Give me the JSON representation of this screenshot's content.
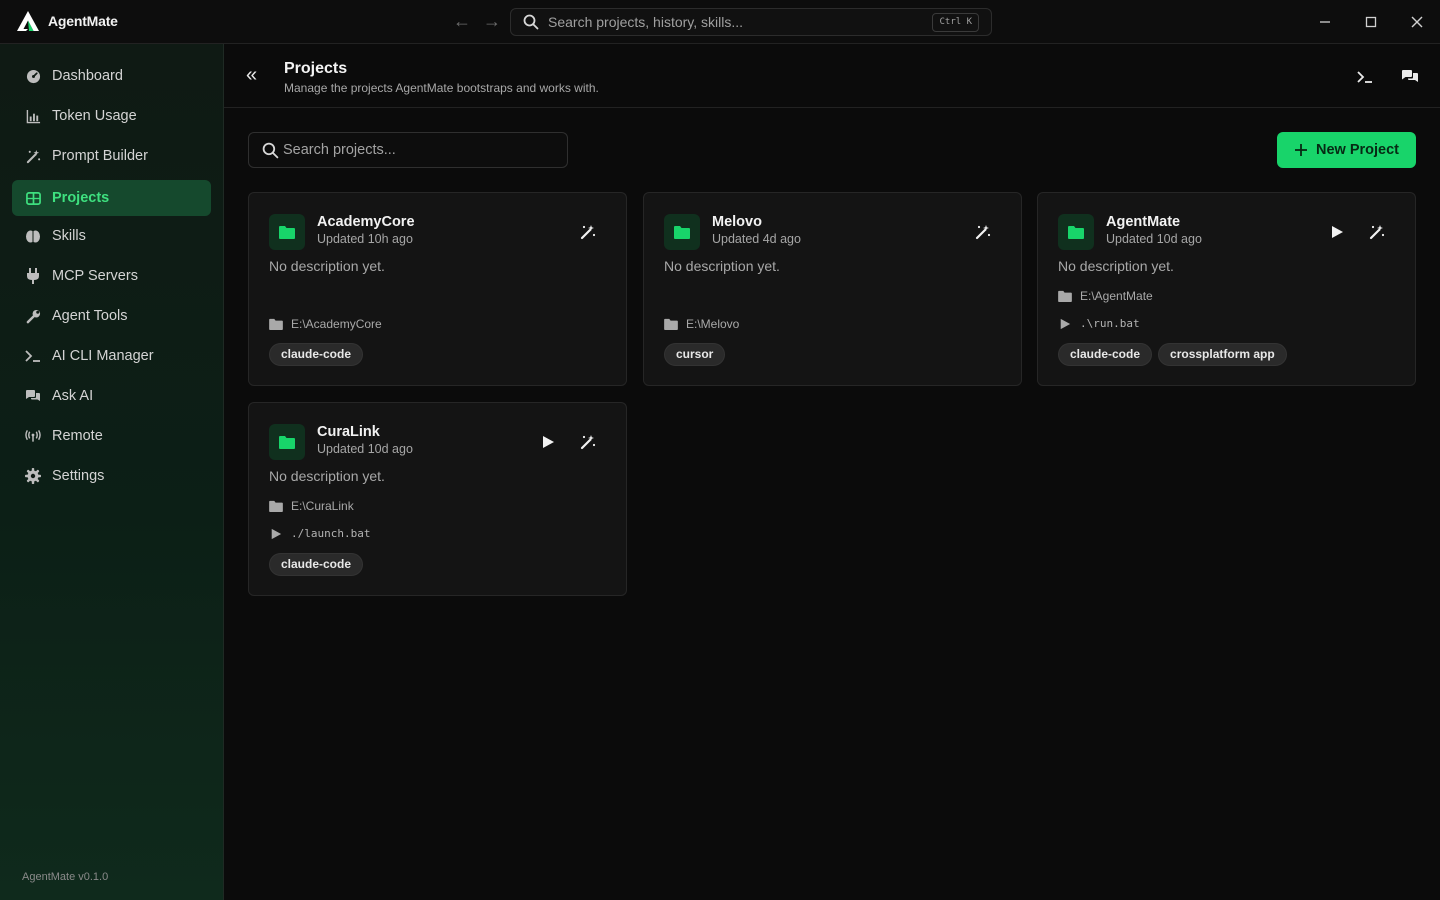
{
  "app": {
    "name": "AgentMate",
    "version": "AgentMate v0.1.0"
  },
  "topbar": {
    "search_placeholder": "Search projects, history, skills...",
    "shortcut": "Ctrl K"
  },
  "sidebar": {
    "items": [
      {
        "label": "Dashboard",
        "icon": "dashboard-icon",
        "active": false
      },
      {
        "label": "Token Usage",
        "icon": "bar-chart-icon",
        "active": false
      },
      {
        "label": "Prompt Builder",
        "icon": "magic-wand-icon",
        "active": false
      },
      {
        "label": "Projects",
        "icon": "columns-icon",
        "active": true
      },
      {
        "label": "Skills",
        "icon": "brain-icon",
        "active": false
      },
      {
        "label": "MCP Servers",
        "icon": "plug-icon",
        "active": false
      },
      {
        "label": "Agent Tools",
        "icon": "wrench-icon",
        "active": false
      },
      {
        "label": "AI CLI Manager",
        "icon": "terminal-icon",
        "active": false
      },
      {
        "label": "Ask AI",
        "icon": "chat-bubbles-icon",
        "active": false
      },
      {
        "label": "Remote",
        "icon": "antenna-icon",
        "active": false
      },
      {
        "label": "Settings",
        "icon": "gear-icon",
        "active": false
      }
    ]
  },
  "header": {
    "title": "Projects",
    "subtitle": "Manage the projects AgentMate bootstraps and works with."
  },
  "toolbar": {
    "search_placeholder": "Search projects...",
    "new_project_label": "New Project"
  },
  "projects": [
    {
      "name": "AcademyCore",
      "updated": "Updated 10h ago",
      "description": "No description yet.",
      "path": "E:\\AcademyCore",
      "run": null,
      "tags": [
        "claude-code"
      ]
    },
    {
      "name": "Melovo",
      "updated": "Updated 4d ago",
      "description": "No description yet.",
      "path": "E:\\Melovo",
      "run": null,
      "tags": [
        "cursor"
      ]
    },
    {
      "name": "AgentMate",
      "updated": "Updated 10d ago",
      "description": "No description yet.",
      "path": "E:\\AgentMate",
      "run": ".\\run.bat",
      "tags": [
        "claude-code",
        "crossplatform app"
      ]
    },
    {
      "name": "CuraLink",
      "updated": "Updated 10d ago",
      "description": "No description yet.",
      "path": "E:\\CuraLink",
      "run": "./launch.bat",
      "tags": [
        "claude-code"
      ]
    }
  ],
  "colors": {
    "accent": "#18d46a",
    "active_bg": "#15492d",
    "active_text": "#3ee07f"
  }
}
